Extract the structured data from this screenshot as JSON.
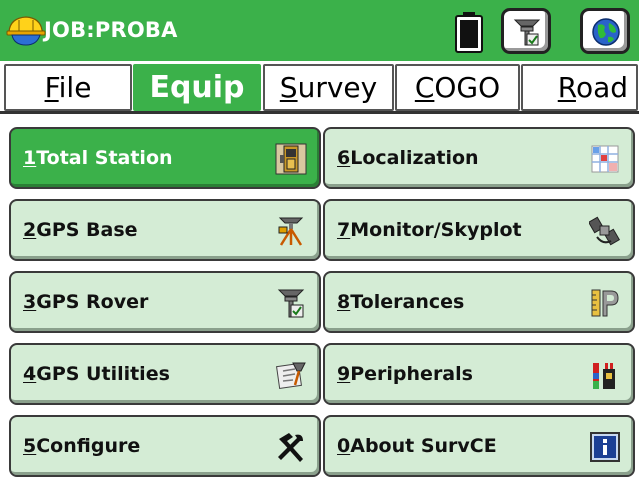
{
  "titlebar": {
    "job_title": "JOB:PROBA",
    "icons": [
      "app-logo-icon",
      "battery-icon",
      "gps-rover-icon",
      "globe-icon"
    ]
  },
  "menu": {
    "tabs": [
      {
        "label": "File",
        "accel": "F",
        "rest": "ile",
        "active": false
      },
      {
        "label": "Equip",
        "accel": "",
        "rest": "Equip",
        "active": true
      },
      {
        "label": "Survey",
        "accel": "S",
        "rest": "urvey",
        "active": false
      },
      {
        "label": "COGO",
        "accel": "C",
        "rest": "OGO",
        "active": false
      },
      {
        "label": "Road",
        "accel": "R",
        "rest": "oad",
        "active": false
      }
    ]
  },
  "buttons": [
    {
      "num": "1",
      "label": "Total Station",
      "icon": "total-station-icon",
      "active": true
    },
    {
      "num": "2",
      "label": "GPS Base",
      "icon": "gps-base-icon",
      "active": false
    },
    {
      "num": "3",
      "label": "GPS Rover",
      "icon": "gps-rover-icon",
      "active": false
    },
    {
      "num": "4",
      "label": "GPS Utilities",
      "icon": "gps-utilities-icon",
      "active": false
    },
    {
      "num": "5",
      "label": "Configure",
      "icon": "tools-icon",
      "active": false
    },
    {
      "num": "6",
      "label": "Localization",
      "icon": "localization-grid-icon",
      "active": false
    },
    {
      "num": "7",
      "label": "Monitor/Skyplot",
      "icon": "satellite-icon",
      "active": false
    },
    {
      "num": "8",
      "label": "Tolerances",
      "icon": "ruler-icon",
      "active": false
    },
    {
      "num": "9",
      "label": "Peripherals",
      "icon": "peripherals-icon",
      "active": false
    },
    {
      "num": "0",
      "label": "About SurvCE",
      "icon": "info-icon",
      "active": false
    }
  ],
  "colors": {
    "accent_green": "#3bb14a",
    "button_bg": "#d4ecd5",
    "info_blue": "#1c3f94"
  }
}
